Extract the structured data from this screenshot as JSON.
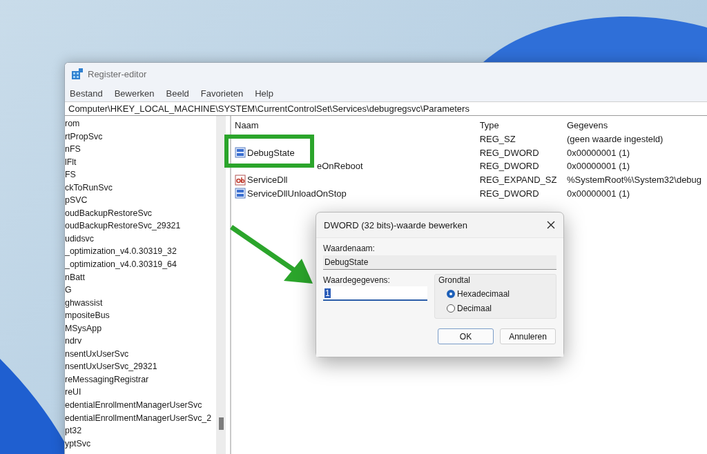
{
  "window": {
    "title": "Register-editor"
  },
  "menu": [
    "Bestand",
    "Bewerken",
    "Beeld",
    "Favorieten",
    "Help"
  ],
  "address": "Computer\\HKEY_LOCAL_MACHINE\\SYSTEM\\CurrentControlSet\\Services\\debugregsvc\\Parameters",
  "tree": {
    "items": [
      "rom",
      "rtPropSvc",
      "nFS",
      "lFlt",
      "FS",
      "ckToRunSvc",
      "pSVC",
      "oudBackupRestoreSvc",
      "oudBackupRestoreSvc_29321",
      "udidsvc",
      "_optimization_v4.0.30319_32",
      "_optimization_v4.0.30319_64",
      "nBatt",
      "G",
      "ghwassist",
      "mpositeBus",
      "MSysApp",
      "ndrv",
      "nsentUxUserSvc",
      "nsentUxUserSvc_29321",
      "reMessagingRegistrar",
      "reUI",
      "edentialEnrollmentManagerUserSvc",
      "edentialEnrollmentManagerUserSvc_2",
      "pt32",
      "yptSvc"
    ]
  },
  "values": {
    "columns": [
      "Naam",
      "Type",
      "Gegevens"
    ],
    "rows": [
      {
        "type": "REG_SZ",
        "data": "(geen waarde ingesteld)"
      },
      {
        "name": "DebugState",
        "kind": "binary",
        "type": "REG_DWORD",
        "data": "0x00000001 (1)"
      },
      {
        "name": "eOnReboot",
        "type": "REG_DWORD",
        "data": "0x00000001 (1)"
      },
      {
        "name": "ServiceDll",
        "kind": "string",
        "type": "REG_EXPAND_SZ",
        "data": "%SystemRoot%\\System32\\debug"
      },
      {
        "name": "ServiceDllUnloadOnStop",
        "kind": "binary",
        "type": "REG_DWORD",
        "data": "0x00000001 (1)"
      }
    ]
  },
  "dialog": {
    "title": "DWORD (32 bits)-waarde bewerken",
    "name_label": "Waardenaam:",
    "name_value": "DebugState",
    "data_label": "Waardegegevens:",
    "data_value": "1",
    "base_label": "Grondtal",
    "options": [
      {
        "label": "Hexadecimaal",
        "selected": true
      },
      {
        "label": "Decimaal",
        "selected": false
      }
    ],
    "buttons": [
      {
        "label": "OK",
        "default": true
      },
      {
        "label": "Annuleren",
        "default": false
      }
    ]
  }
}
